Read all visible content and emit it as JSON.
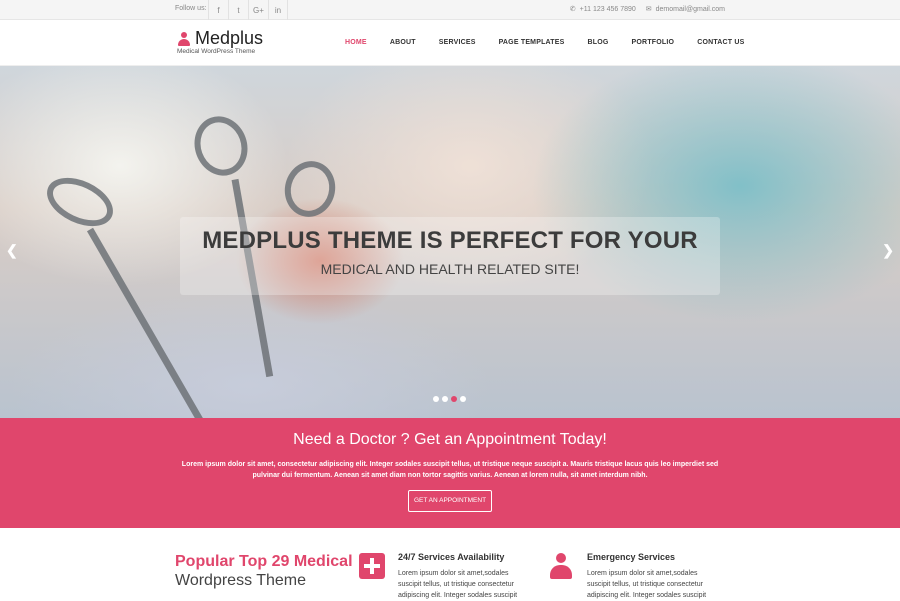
{
  "topbar": {
    "follow_label": "Follow us:",
    "social": [
      "f",
      "t",
      "G+",
      "in"
    ],
    "phone": "+11 123 456 7890",
    "email": "demomail@gmail.com"
  },
  "brand": {
    "name": "Medplus",
    "tagline": "Medical WordPress Theme",
    "accent": "#e0466c"
  },
  "nav": [
    "HOME",
    "ABOUT",
    "SERVICES",
    "PAGE TEMPLATES",
    "BLOG",
    "PORTFOLIO",
    "CONTACT US"
  ],
  "hero": {
    "title": "MEDPLUS THEME IS PERFECT FOR YOUR",
    "subtitle": "MEDICAL AND HEALTH RELATED SITE!",
    "prev_icon": "chevron-left-icon",
    "next_icon": "chevron-right-icon",
    "slides": 4,
    "active_slide": 3
  },
  "appointment": {
    "title": "Need a Doctor ? Get an Appointment Today!",
    "text": "Lorem ipsum dolor sit amet, consectetur adipiscing elit. Integer sodales suscipit tellus, ut tristique neque suscipit a. Mauris tristique lacus quis leo imperdiet sed pulvinar dui fermentum. Aenean sit amet diam non tortor sagittis varius. Aenean at lorem nulla, sit amet interdum nibh.",
    "button": "GET AN APPOINTMENT"
  },
  "features": {
    "title_highlight": "Popular Top 29 Medical",
    "title_rest": "Wordpress Theme",
    "items": [
      {
        "icon": "medical-cross-icon",
        "name": "24/7 Services Availability",
        "desc": "Lorem ipsum dolor sit amet,sodales suscipit tellus, ut tristique consectetur adipiscing elit. Integer sodales suscipit"
      },
      {
        "icon": "doctor-icon",
        "name": "Emergency Services",
        "desc": "Lorem ipsum dolor sit amet,sodales suscipit tellus, ut tristique consectetur adipiscing elit. Integer sodales suscipit"
      }
    ]
  }
}
